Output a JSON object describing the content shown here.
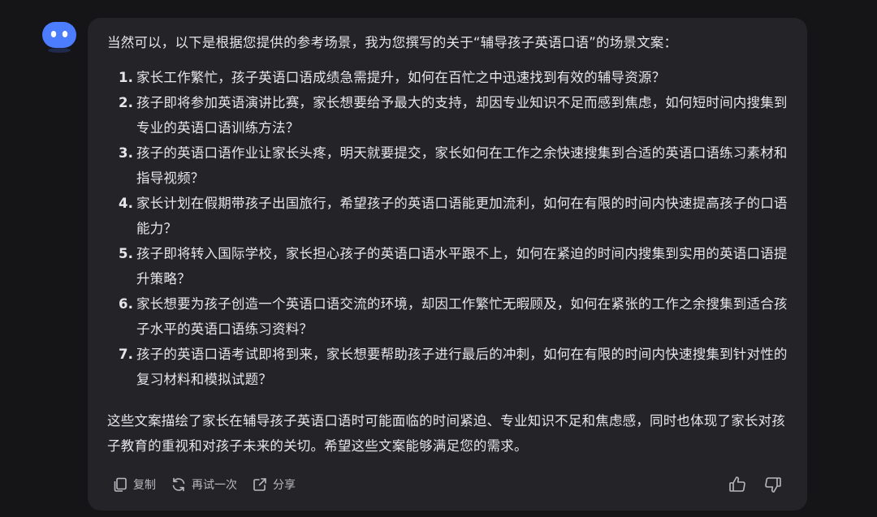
{
  "message": {
    "intro": "当然可以，以下是根据您提供的参考场景，我为您撰写的关于“辅导孩子英语口语”的场景文案：",
    "items": [
      {
        "num": "1.",
        "text": "家长工作繁忙，孩子英语口语成绩急需提升，如何在百忙之中迅速找到有效的辅导资源？"
      },
      {
        "num": "2.",
        "text": "孩子即将参加英语演讲比赛，家长想要给予最大的支持，却因专业知识不足而感到焦虑，如何短时间内搜集到专业的英语口语训练方法？"
      },
      {
        "num": "3.",
        "text": "孩子的英语口语作业让家长头疼，明天就要提交，家长如何在工作之余快速搜集到合适的英语口语练习素材和指导视频？"
      },
      {
        "num": "4.",
        "text": "家长计划在假期带孩子出国旅行，希望孩子的英语口语能更加流利，如何在有限的时间内快速提高孩子的口语能力？"
      },
      {
        "num": "5.",
        "text": "孩子即将转入国际学校，家长担心孩子的英语口语水平跟不上，如何在紧迫的时间内搜集到实用的英语口语提升策略？"
      },
      {
        "num": "6.",
        "text": "家长想要为孩子创造一个英语口语交流的环境，却因工作繁忙无暇顾及，如何在紧张的工作之余搜集到适合孩子水平的英语口语练习资料？"
      },
      {
        "num": "7.",
        "text": "孩子的英语口语考试即将到来，家长想要帮助孩子进行最后的冲刺，如何在有限的时间内快速搜集到针对性的复习材料和模拟试题？"
      }
    ],
    "outro": "这些文案描绘了家长在辅导孩子英语口语时可能面临的时间紧迫、专业知识不足和焦虑感，同时也体现了家长对孩子教育的重视和对孩子未来的关切。希望这些文案能够满足您的需求。"
  },
  "actions": {
    "copy": "复制",
    "retry": "再试一次",
    "share": "分享"
  },
  "icons": {
    "avatar": "bot-avatar-icon",
    "copy": "copy-icon",
    "retry": "refresh-icon",
    "share": "share-icon",
    "like": "thumbs-up-icon",
    "dislike": "thumbs-down-icon"
  },
  "colors": {
    "background": "#151518",
    "bubble": "#242428",
    "avatar": "#4c7dff",
    "text": "#e6e6ea",
    "muted": "#b8b8c0"
  }
}
